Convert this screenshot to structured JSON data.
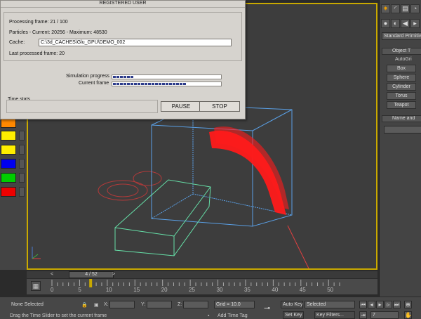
{
  "dialog": {
    "registered_label": "REGISTERED USER",
    "processing": "Processing frame: 21 / 100",
    "particles": "Particles - Current: 20256 - Maximum: 48530",
    "cache_label": "Cache:",
    "cache_value": "C:\\3d_CACHES\\Glu_GPU\\DEMO_002",
    "last_frame": "Last processed frame: 20",
    "sim_progress_label": "Simulation progress",
    "current_frame_label": "Current frame",
    "sim_progress": 0.19,
    "current_frame_progress": 0.68,
    "time_stats_label": "Time stats",
    "pause_label": "PAUSE",
    "stop_label": "STOP"
  },
  "color_swatches": [
    "#ff8800",
    "#ffee00",
    "#0000ee",
    "#00cc00",
    "#ee0000"
  ],
  "right_panel": {
    "dropdown": "Standard Primitive",
    "object_type_label": "Object T",
    "autogrid_label": "AutoGri",
    "buttons": [
      "Box",
      "Sphere",
      "Cylinder",
      "Torus",
      "Teapot"
    ],
    "name_label": "Name and"
  },
  "timeline": {
    "slider_label": "4 / 52",
    "ticks": [
      "0",
      "5",
      "10",
      "15",
      "20",
      "25",
      "30",
      "35",
      "40",
      "45",
      "50"
    ],
    "prev": "<",
    "next": ">"
  },
  "status_bar": {
    "selection": "None Selected",
    "prompt": "Drag the Time Slider to set the current frame",
    "x_label": "X:",
    "y_label": "Y:",
    "z_label": "Z:",
    "grid": "Grid = 10.0",
    "add_time_tag": "Add Time Tag",
    "auto_key": "Auto Key",
    "set_key": "Set Key",
    "selected_dropdown": "Selected",
    "key_filters": "Key Filters...",
    "frame_field": "7"
  },
  "colors": {
    "viewport_border": "#c9a900",
    "particles": "#ff1a1a",
    "box_wire": "#5aa0e6",
    "slab_wire": "#66e0a8"
  }
}
